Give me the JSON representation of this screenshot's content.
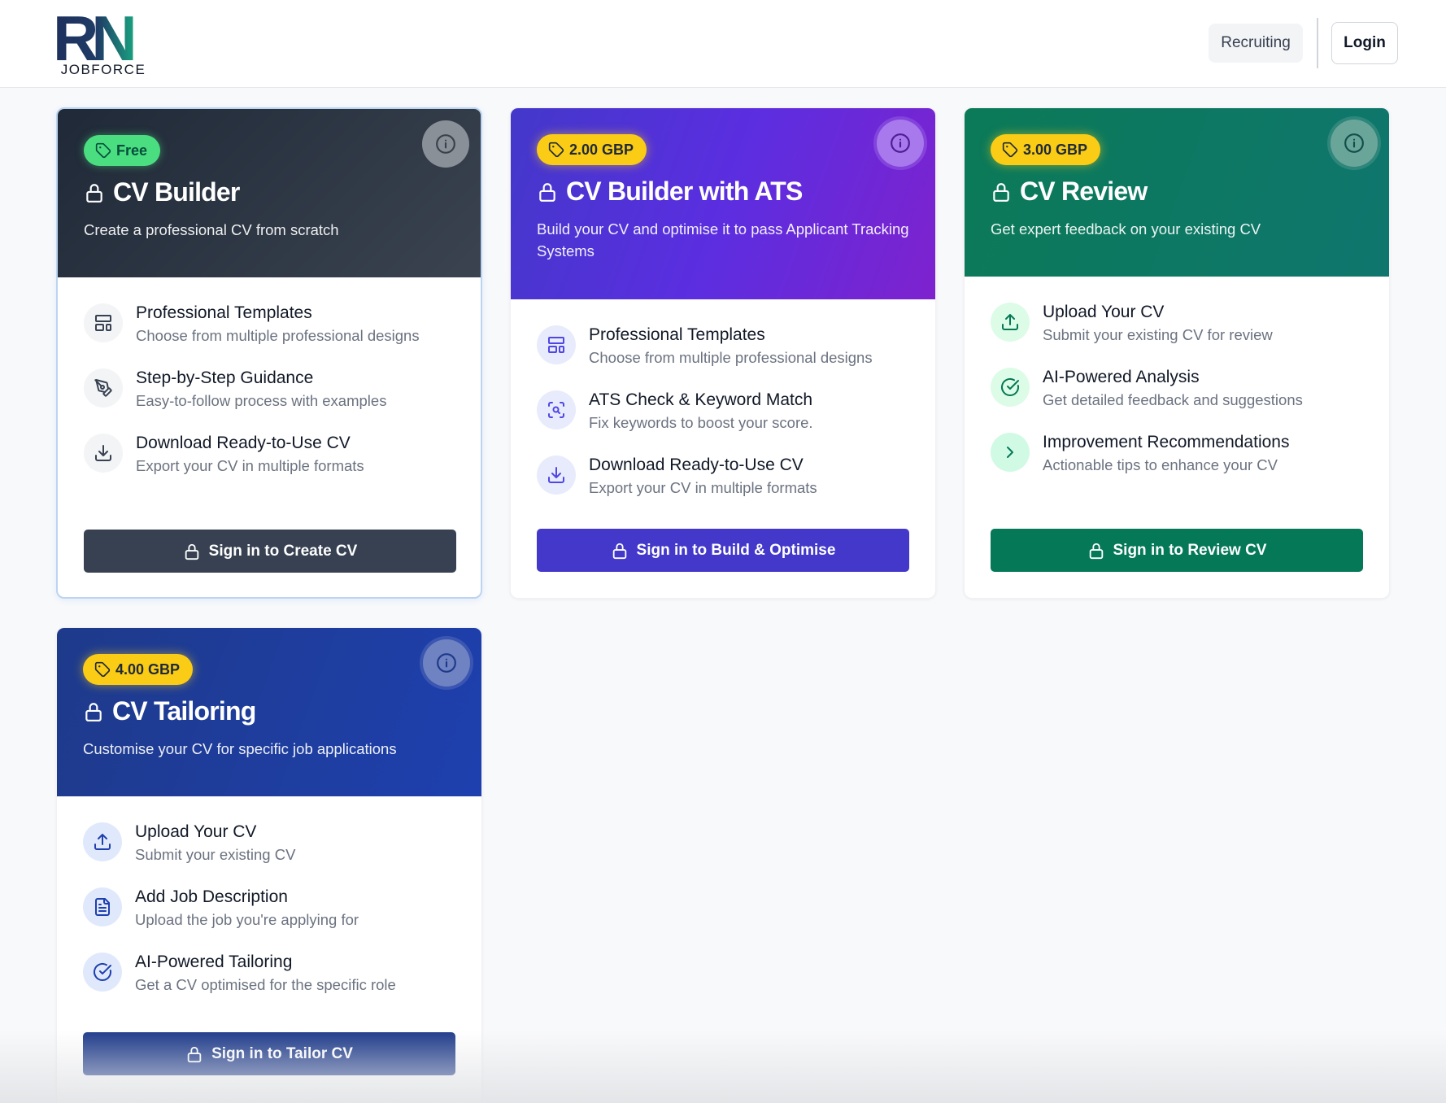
{
  "header": {
    "logo_letters": "RN",
    "logo_sub": "JOBFORCE",
    "nav": {
      "recruiting_label": "Recruiting",
      "login_label": "Login"
    }
  },
  "colors": {
    "cv_builder": "#2f3742",
    "cv_builder_ats": "#5b2ee0",
    "cv_review": "#0c7c63",
    "cv_tailoring": "#1e3a9a",
    "badge_free": "#4ade80",
    "badge_price": "#facc15"
  },
  "cards": [
    {
      "badge": "Free",
      "title": "CV Builder",
      "subtitle": "Create a professional CV from scratch",
      "features": [
        {
          "icon": "layout-template-icon",
          "title": "Professional Templates",
          "desc": "Choose from multiple professional designs"
        },
        {
          "icon": "pen-tool-icon",
          "title": "Step-by-Step Guidance",
          "desc": "Easy-to-follow process with examples"
        },
        {
          "icon": "download-icon",
          "title": "Download Ready-to-Use CV",
          "desc": "Export your CV in multiple formats"
        }
      ],
      "cta": "Sign in to Create CV"
    },
    {
      "badge": "2.00 GBP",
      "title": "CV Builder with ATS",
      "subtitle": "Build your CV and optimise it to pass Applicant Tracking Systems",
      "features": [
        {
          "icon": "layout-template-icon",
          "title": "Professional Templates",
          "desc": "Choose from multiple professional designs"
        },
        {
          "icon": "scan-search-icon",
          "title": "ATS Check & Keyword Match",
          "desc": "Fix keywords to boost your score."
        },
        {
          "icon": "download-icon",
          "title": "Download Ready-to-Use CV",
          "desc": "Export your CV in multiple formats"
        }
      ],
      "cta": "Sign in to Build & Optimise"
    },
    {
      "badge": "3.00 GBP",
      "title": "CV Review",
      "subtitle": "Get expert feedback on your existing CV",
      "features": [
        {
          "icon": "upload-icon",
          "title": "Upload Your CV",
          "desc": "Submit your existing CV for review"
        },
        {
          "icon": "check-circle-icon",
          "title": "AI-Powered Analysis",
          "desc": "Get detailed feedback and suggestions"
        },
        {
          "icon": "chevron-right-icon",
          "title": "Improvement Recommendations",
          "desc": "Actionable tips to enhance your CV"
        }
      ],
      "cta": "Sign in to Review CV"
    },
    {
      "badge": "4.00 GBP",
      "title": "CV Tailoring",
      "subtitle": "Customise your CV for specific job applications",
      "features": [
        {
          "icon": "upload-icon",
          "title": "Upload Your CV",
          "desc": "Submit your existing CV"
        },
        {
          "icon": "file-text-icon",
          "title": "Add Job Description",
          "desc": "Upload the job you're applying for"
        },
        {
          "icon": "check-circle-icon",
          "title": "AI-Powered Tailoring",
          "desc": "Get a CV optimised for the specific role"
        }
      ],
      "cta": "Sign in to Tailor CV"
    }
  ]
}
